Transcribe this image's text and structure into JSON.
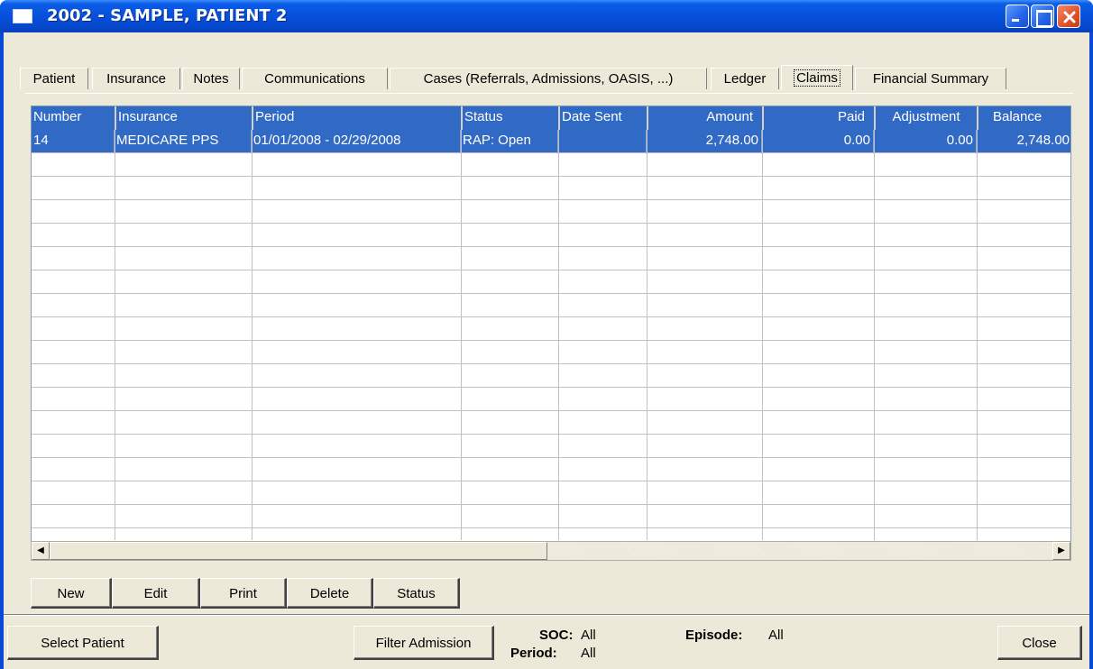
{
  "window": {
    "title": "2002 - SAMPLE, PATIENT 2"
  },
  "tabs": [
    {
      "label": "Patient",
      "active": false
    },
    {
      "label": "Insurance",
      "active": false
    },
    {
      "label": "Notes",
      "active": false
    },
    {
      "label": "Communications",
      "active": false
    },
    {
      "label": "Cases (Referrals, Admissions, OASIS, ...)",
      "active": false
    },
    {
      "label": "Ledger",
      "active": false
    },
    {
      "label": "Claims",
      "active": true
    },
    {
      "label": "Financial Summary",
      "active": false
    }
  ],
  "grid": {
    "columns": [
      "Number",
      "Insurance",
      "Period",
      "Status",
      "Date Sent",
      "Amount",
      "Paid",
      "Adjustment",
      "Balance"
    ],
    "rows": [
      [
        "14",
        "MEDICARE PPS",
        "01/01/2008 - 02/29/2008",
        "RAP: Open",
        "",
        "2,748.00",
        "0.00",
        "0.00",
        "2,748.00"
      ]
    ]
  },
  "actions": {
    "new_label": "New",
    "edit_label": "Edit",
    "print_label": "Print",
    "delete_label": "Delete",
    "status_label": "Status"
  },
  "footer": {
    "select_patient_label": "Select Patient",
    "filter_admission_label": "Filter Admission",
    "soc_label": "SOC:",
    "soc_value": "All",
    "period_label": "Period:",
    "period_value": "All",
    "episode_label": "Episode:",
    "episode_value": "All",
    "close_label": "Close"
  },
  "colors": {
    "title_bar": "#0750dc",
    "selection": "#316ac5",
    "face": "#ece9d8"
  },
  "icons": [
    "window-icon",
    "minimize-icon",
    "maximize-icon",
    "close-icon",
    "scroll-left-icon",
    "scroll-right-icon"
  ]
}
